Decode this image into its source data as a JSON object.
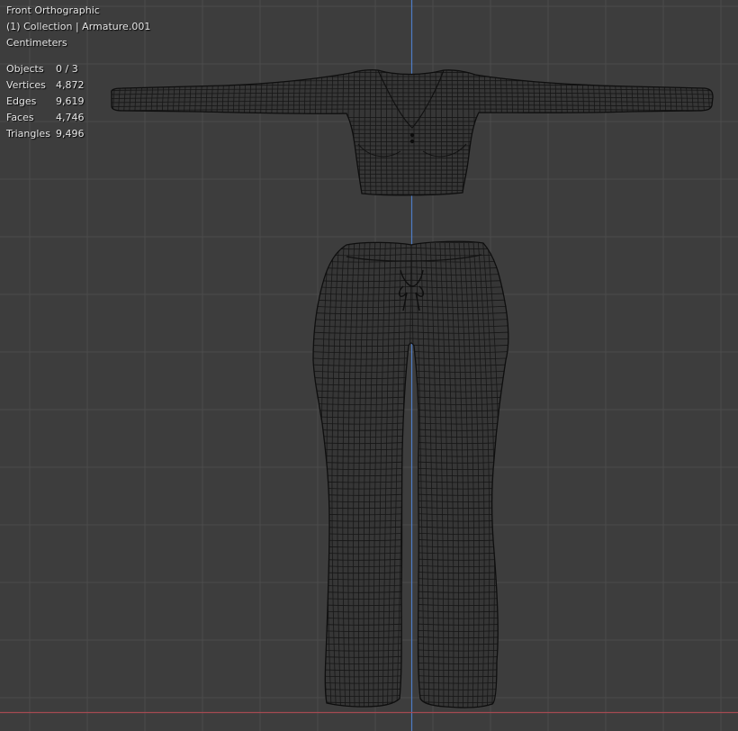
{
  "viewport": {
    "view_name": "Front Orthographic",
    "collection_info": "(1) Collection | Armature.001",
    "units": "Centimeters"
  },
  "stats": [
    {
      "label": "Objects",
      "value": "0 / 3"
    },
    {
      "label": "Vertices",
      "value": "4,872"
    },
    {
      "label": "Edges",
      "value": "9,619"
    },
    {
      "label": "Faces",
      "value": "4,746"
    },
    {
      "label": "Triangles",
      "value": "9,496"
    }
  ],
  "colors": {
    "background": "#3d3d3d",
    "grid_line": "#4a4a4a",
    "z_axis": "#5a84c4",
    "x_axis": "#a84a4f",
    "wire": "#141414",
    "mesh_fill": "#363636",
    "text": "#e6e6e6"
  }
}
